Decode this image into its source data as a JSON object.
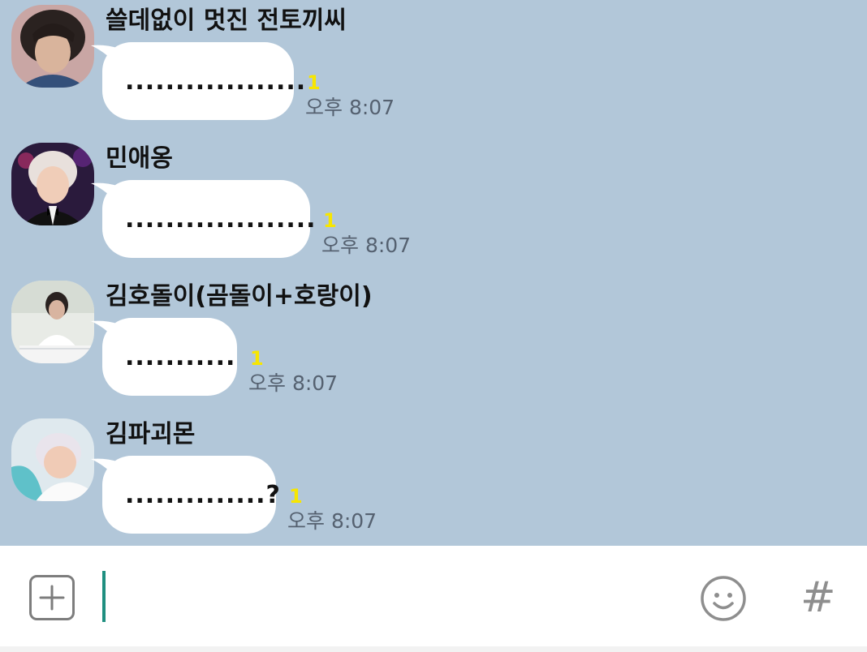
{
  "colors": {
    "chat_background": "#b2c7d9",
    "bubble": "#ffffff",
    "unread_count": "#f7e600",
    "timestamp": "#556170",
    "cursor": "#1f8f80"
  },
  "messages": [
    {
      "sender": "쓸데없이 멋진 전토끼씨",
      "text": "..................",
      "unread": "1",
      "time": "오후 8:07",
      "avatar": "profile-photo"
    },
    {
      "sender": "민애옹",
      "text": "...................",
      "unread": "1",
      "time": "오후 8:07",
      "avatar": "profile-photo"
    },
    {
      "sender": "김호돌이(곰돌이+호랑이)",
      "text": "...........",
      "unread": "1",
      "time": "오후 8:07",
      "avatar": "profile-photo"
    },
    {
      "sender": "김파괴몬",
      "text": "..............?",
      "unread": "1",
      "time": "오후 8:07",
      "avatar": "profile-photo"
    }
  ],
  "input": {
    "value": "",
    "placeholder": "",
    "plus_icon": "plus-square-icon",
    "emoji_icon": "smiley-icon",
    "hashtag_label": "#"
  }
}
